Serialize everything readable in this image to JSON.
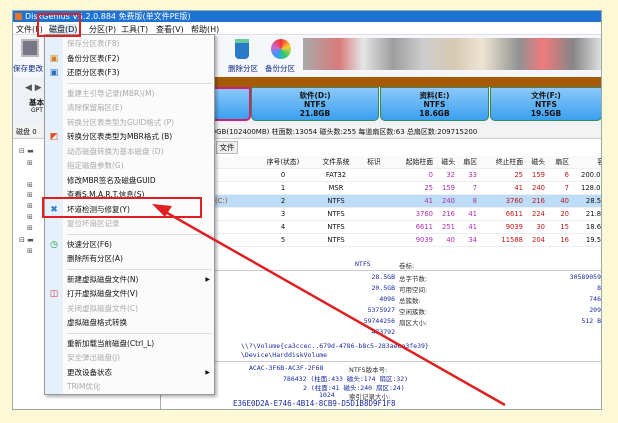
{
  "window": {
    "title": "DiskGenius V5.2.0.884 免费版(单文件PE版)"
  },
  "menubar": [
    "文件(F)",
    "磁盘(D)",
    "分区(P)",
    "工具(T)",
    "查看(V)",
    "帮助(H)"
  ],
  "toolbar": {
    "save": "保存更改",
    "delete": "删除分区",
    "backup": "备份分区"
  },
  "disk_nav": {
    "type": "基本",
    "style": "GPT"
  },
  "partitions": [
    {
      "name": "软件(D:)",
      "fs": "NTFS",
      "size": "21.8GB"
    },
    {
      "name": "资料(E:)",
      "fs": "NTFS",
      "size": "18.6GB"
    },
    {
      "name": "文件(F:)",
      "fs": "NTFS",
      "size": "19.5GB"
    }
  ],
  "disk_info": {
    "prefix": "磁盘 0",
    "text": "0.0GB(102400MB)  柱面数:13054  磁头数:255  每道扇区数:63  总扇区数:209715200"
  },
  "tab": "文件",
  "table": {
    "headers": [
      "序号(状态)",
      "文件系统",
      "标识",
      "起始柱面",
      "磁头",
      "扇区",
      "终止柱面",
      "磁头",
      "扇区",
      "容量"
    ],
    "rows": [
      {
        "label": "",
        "cells": [
          "0",
          "FAT32",
          "",
          "0",
          "32",
          "33",
          "25",
          "159",
          "6",
          "200.0MB"
        ]
      },
      {
        "label": "",
        "cells": [
          "1",
          "MSR",
          "",
          "25",
          "159",
          "7",
          "41",
          "240",
          "7",
          "128.0MB"
        ]
      },
      {
        "label": "(C:)",
        "cells": [
          "2",
          "NTFS",
          "",
          "41",
          "240",
          "8",
          "3760",
          "216",
          "40",
          "28.5GB"
        ]
      },
      {
        "label": "",
        "cells": [
          "3",
          "NTFS",
          "",
          "3760",
          "216",
          "41",
          "6611",
          "224",
          "20",
          "21.8GB"
        ]
      },
      {
        "label": "",
        "cells": [
          "4",
          "NTFS",
          "",
          "6611",
          "251",
          "41",
          "9039",
          "30",
          "15",
          "18.6GB"
        ]
      },
      {
        "label": "",
        "cells": [
          "5",
          "NTFS",
          "",
          "9039",
          "40",
          "34",
          "11588",
          "204",
          "16",
          "19.5GB"
        ]
      }
    ],
    "selected_row": 2
  },
  "details": {
    "fs": "NTFS",
    "volume_label": "卷标:",
    "pairs": [
      {
        "value": "28.5GB",
        "label": "总字节数:",
        "right": "30589059"
      },
      {
        "value": "20.5GB",
        "label": "可用空间:",
        "right": "8"
      },
      {
        "value": "4096",
        "label": "总簇数:",
        "right": "746"
      },
      {
        "value": "5375927",
        "label": "空闲簇数:",
        "right": "209"
      },
      {
        "value": "59744256",
        "label": "扇区大小:",
        "right": "512 B"
      },
      {
        "value": "473792",
        "label": "",
        "right": ""
      }
    ],
    "volume_guid": "\\\\?\\Volume{ca3ccec..679d-4786-b8c5-283aeea3fe39}",
    "device": "\\Device\\HarddiskVolume",
    "serial": "ACAC-3F6B-AC3F-2F68",
    "ntfs_version_label": "NTFS版本号:",
    "mft": "786432 (柱面:433 磁头:1?4 扇区:32)",
    "mft_mirror": "2 (柱面:41 磁头:240 扇区:24)",
    "index_size": "1024",
    "index_label": "索引记录大小:",
    "guid": "E36E0D2A-E746-4B14-8CB9-D5D1B8D9F1F8"
  },
  "disk_menu": {
    "items": [
      {
        "label": "保存分区表(F8)",
        "disabled": true
      },
      {
        "label": "备份分区表(F2)",
        "icon": "backup-icon"
      },
      {
        "label": "还原分区表(F3)",
        "icon": "restore-icon"
      },
      {
        "sep": true
      },
      {
        "label": "重建主引导记录(MBR)(M)",
        "disabled": true
      },
      {
        "label": "清除保留扇区(E)",
        "disabled": true
      },
      {
        "label": "转换分区表类型为GUID格式 (P)",
        "disabled": true
      },
      {
        "label": "转换分区表类型为MBR格式 (B)",
        "icon": "convert-icon"
      },
      {
        "label": "动态磁盘转换为基本磁盘 (D)",
        "disabled": true
      },
      {
        "label": "指定磁盘参数(G)",
        "disabled": true
      },
      {
        "label": "修改MBR签名及磁盘GUID"
      },
      {
        "label": "查看S.M.A.R.T.信息(S)"
      },
      {
        "label": "坏道检测与修复(Y)",
        "icon": "tools-icon",
        "highlighted": true
      },
      {
        "label": "复位坏扇区记录",
        "disabled": true
      },
      {
        "sep": true
      },
      {
        "label": "快速分区(F6)",
        "icon": "clock-icon"
      },
      {
        "label": "删除所有分区(A)"
      },
      {
        "sep": true
      },
      {
        "label": "新建虚拟磁盘文件(N)",
        "submenu": true
      },
      {
        "label": "打开虚拟磁盘文件(V)",
        "icon": "open-disk-icon"
      },
      {
        "label": "关闭虚拟磁盘文件(C)",
        "disabled": true
      },
      {
        "label": "虚拟磁盘格式转换"
      },
      {
        "sep": true
      },
      {
        "label": "重新加载当前磁盘(Ctrl_L)"
      },
      {
        "label": "安全弹出磁盘(J)",
        "disabled": true
      },
      {
        "label": "更改设备状态",
        "submenu": true
      },
      {
        "label": "TRIM优化",
        "disabled": true
      }
    ]
  },
  "colors": {
    "title_bar": "#1e73d2",
    "highlight": "#e02020",
    "partition_strip": "#a65a08",
    "background": "#fdf8d6"
  }
}
